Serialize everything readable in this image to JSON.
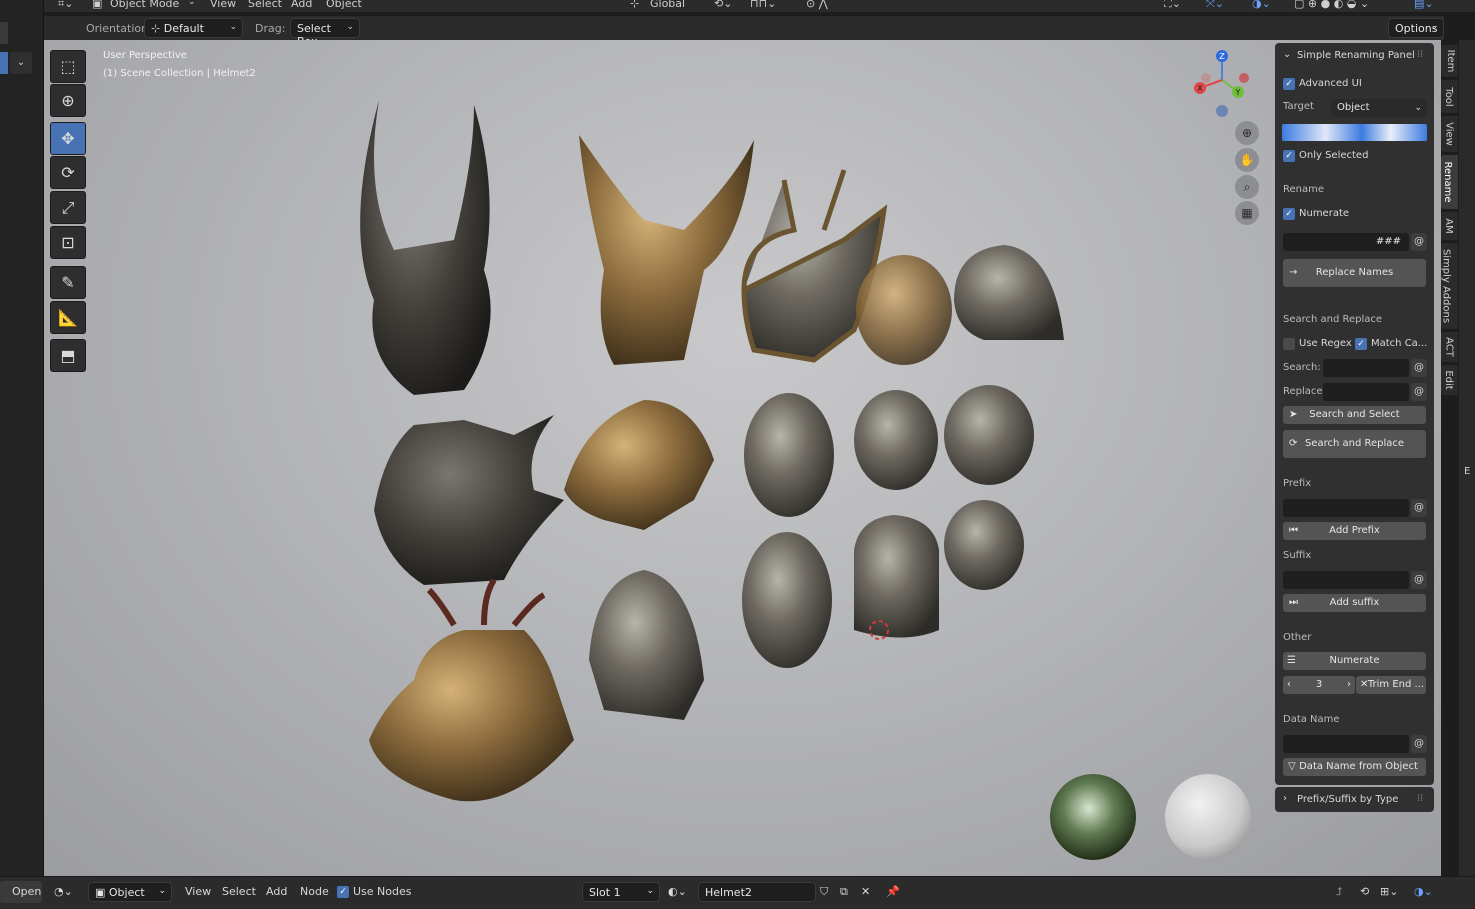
{
  "top": {
    "mode": "Object Mode",
    "menus": [
      "View",
      "Select",
      "Add",
      "Object"
    ],
    "transform_orientation": "Global"
  },
  "header": {
    "orientation_label": "Orientation:",
    "orientation_value": "Default",
    "drag_label": "Drag:",
    "drag_value": "Select Box",
    "options_label": "Options"
  },
  "viewport": {
    "perspective": "User Perspective",
    "collection": "(1) Scene Collection | Helmet2",
    "gizmo_axes": [
      "X",
      "Y",
      "Z"
    ]
  },
  "toolbar": {
    "tools": [
      "select-box",
      "cursor",
      "move",
      "rotate",
      "scale",
      "transform",
      "annotate",
      "measure",
      "add-cube"
    ],
    "active": "move"
  },
  "panel": {
    "title": "Simple Renaming Panel",
    "advanced_ui": "Advanced UI",
    "target_label": "Target",
    "target_value": "Object",
    "only_selected": "Only Selected",
    "rename_header": "Rename",
    "numerate": "Numerate",
    "numerate_pattern": "###",
    "at": "@",
    "replace_names": "Replace Names",
    "search_replace_header": "Search and Replace",
    "use_regex": "Use Regex",
    "match_case": "Match Ca...",
    "search_label": "Search:",
    "replace_label": "Replace:",
    "search_and_select": "Search and Select",
    "search_and_replace": "Search and Replace",
    "prefix_header": "Prefix",
    "add_prefix": "Add Prefix",
    "suffix_header": "Suffix",
    "add_suffix": "Add suffix",
    "other_header": "Other",
    "numerate_btn": "Numerate",
    "trim_value": "3",
    "trim_end": "Trim End ...",
    "data_name_header": "Data Name",
    "data_name_from_object": "Data Name from Object",
    "prefix_suffix_by_type": "Prefix/Suffix by Type"
  },
  "tabs": [
    "Item",
    "Tool",
    "View",
    "Rename",
    "AM",
    "Simply Addons",
    "ACT",
    "Edit"
  ],
  "selected_tab": "Rename",
  "bottom": {
    "open": "Open",
    "object": "Object",
    "menus": [
      "View",
      "Select",
      "Add",
      "Node"
    ],
    "use_nodes": "Use Nodes",
    "slot": "Slot 1",
    "material": "Helmet2"
  },
  "colors": {
    "accent": "#4772b3",
    "panel": "#303030",
    "header": "#2b2b2b"
  }
}
